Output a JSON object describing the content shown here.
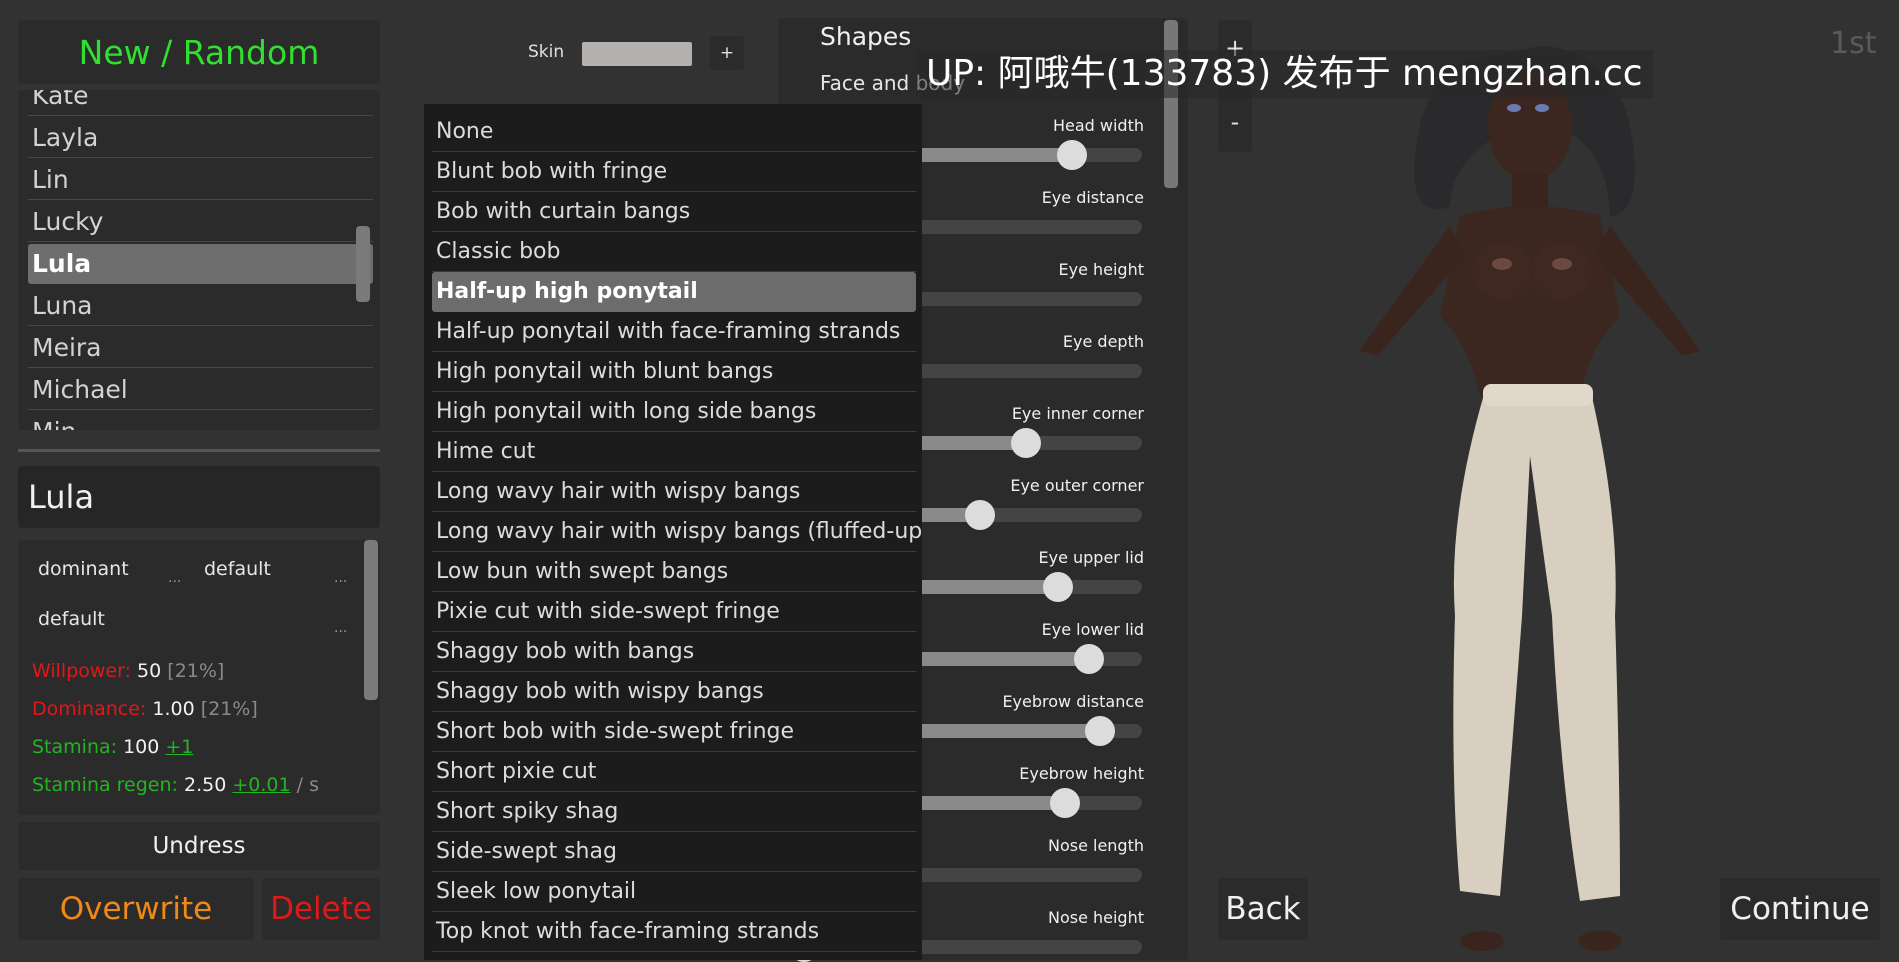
{
  "left": {
    "new_random": "New / Random",
    "characters": [
      "Kate",
      "Layla",
      "Lin",
      "Lucky",
      "Lula",
      "Luna",
      "Meira",
      "Michael",
      "Min"
    ],
    "selected_character": "Lula",
    "name": "Lula",
    "attrs": {
      "chip1": "dominant",
      "chip2": "default",
      "chip3": "default",
      "dots": "...",
      "willpower_label": "Willpower:",
      "willpower_value": "50",
      "willpower_pct": "[21%]",
      "dominance_label": "Dominance:",
      "dominance_value": "1.00",
      "dominance_pct": "[21%]",
      "stamina_label": "Stamina:",
      "stamina_value": "100",
      "stamina_bonus": "+1",
      "regen_label": "Stamina regen:",
      "regen_value": "2.50",
      "regen_bonus": "+0.01",
      "regen_unit": "/ s"
    },
    "undress": "Undress",
    "overwrite": "Overwrite",
    "delete": "Delete"
  },
  "skin": {
    "label": "Skin",
    "plus": "+",
    "color": "#b3b0ad"
  },
  "shapes": {
    "title": "Shapes",
    "section": "Face and body",
    "sliders": [
      {
        "label": "Head width",
        "value": 0.8
      },
      {
        "label": "Eye distance",
        "value": 0.28
      },
      {
        "label": "Eye height",
        "value": 0.31
      },
      {
        "label": "Eye depth",
        "value": 0.0
      },
      {
        "label": "Eye inner corner",
        "value": 0.67
      },
      {
        "label": "Eye outer corner",
        "value": 0.54
      },
      {
        "label": "Eye upper lid",
        "value": 0.76
      },
      {
        "label": "Eye lower lid",
        "value": 0.85
      },
      {
        "label": "Eyebrow distance",
        "value": 0.88
      },
      {
        "label": "Eyebrow height",
        "value": 0.78
      },
      {
        "label": "Nose length",
        "value": 0.07
      },
      {
        "label": "Nose height",
        "value": 0.04
      }
    ]
  },
  "hair_options": [
    "None",
    "Blunt bob with fringe",
    "Bob with curtain bangs",
    "Classic bob",
    "Half-up high ponytail",
    "Half-up ponytail with face-framing strands",
    "High ponytail with blunt bangs",
    "High ponytail with long side bangs",
    "Hime cut",
    "Long wavy hair with wispy bangs",
    "Long wavy hair with wispy bangs (fluffed-up)",
    "Low bun with swept bangs",
    "Pixie cut with side-swept fringe",
    "Shaggy bob with bangs",
    "Shaggy bob with wispy bangs",
    "Short bob with side-swept fringe",
    "Short pixie cut",
    "Short spiky shag",
    "Side-swept shag",
    "Sleek low ponytail",
    "Top knot with face-framing strands"
  ],
  "hair_selected": "Half-up high ponytail",
  "viewport": {
    "zoom_in": "+",
    "zoom_out": "-",
    "camera": "1st",
    "watermark": "UP: 阿哦牛(133783) 发布于 mengzhan.cc",
    "back": "Back",
    "continue": "Continue"
  }
}
